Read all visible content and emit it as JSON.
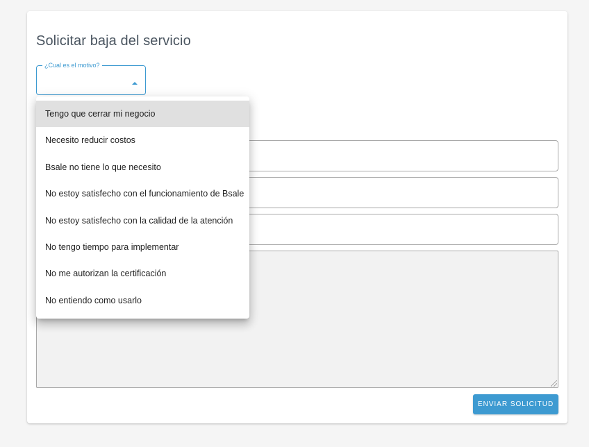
{
  "form": {
    "title": "Solicitar baja del servicio",
    "reason_label": "¿Cual es el motivo?",
    "submit_label": "ENVIAR SOLICITUD"
  },
  "menu": {
    "items": [
      {
        "label": "Tengo que cerrar mi negocio",
        "highlighted": true
      },
      {
        "label": "Necesito reducir costos"
      },
      {
        "label": "Bsale no tiene lo que necesito"
      },
      {
        "label": "No estoy satisfecho con el funcionamiento de Bsale"
      },
      {
        "label": "No estoy satisfecho con la calidad de la atención"
      },
      {
        "label": "No tengo tiempo para implementar"
      },
      {
        "label": "No me autorizan la certificación"
      },
      {
        "label": "No entiendo como usarlo"
      }
    ]
  },
  "colors": {
    "accent": "#3d9ad1",
    "highlight": "#e0e0e0"
  }
}
